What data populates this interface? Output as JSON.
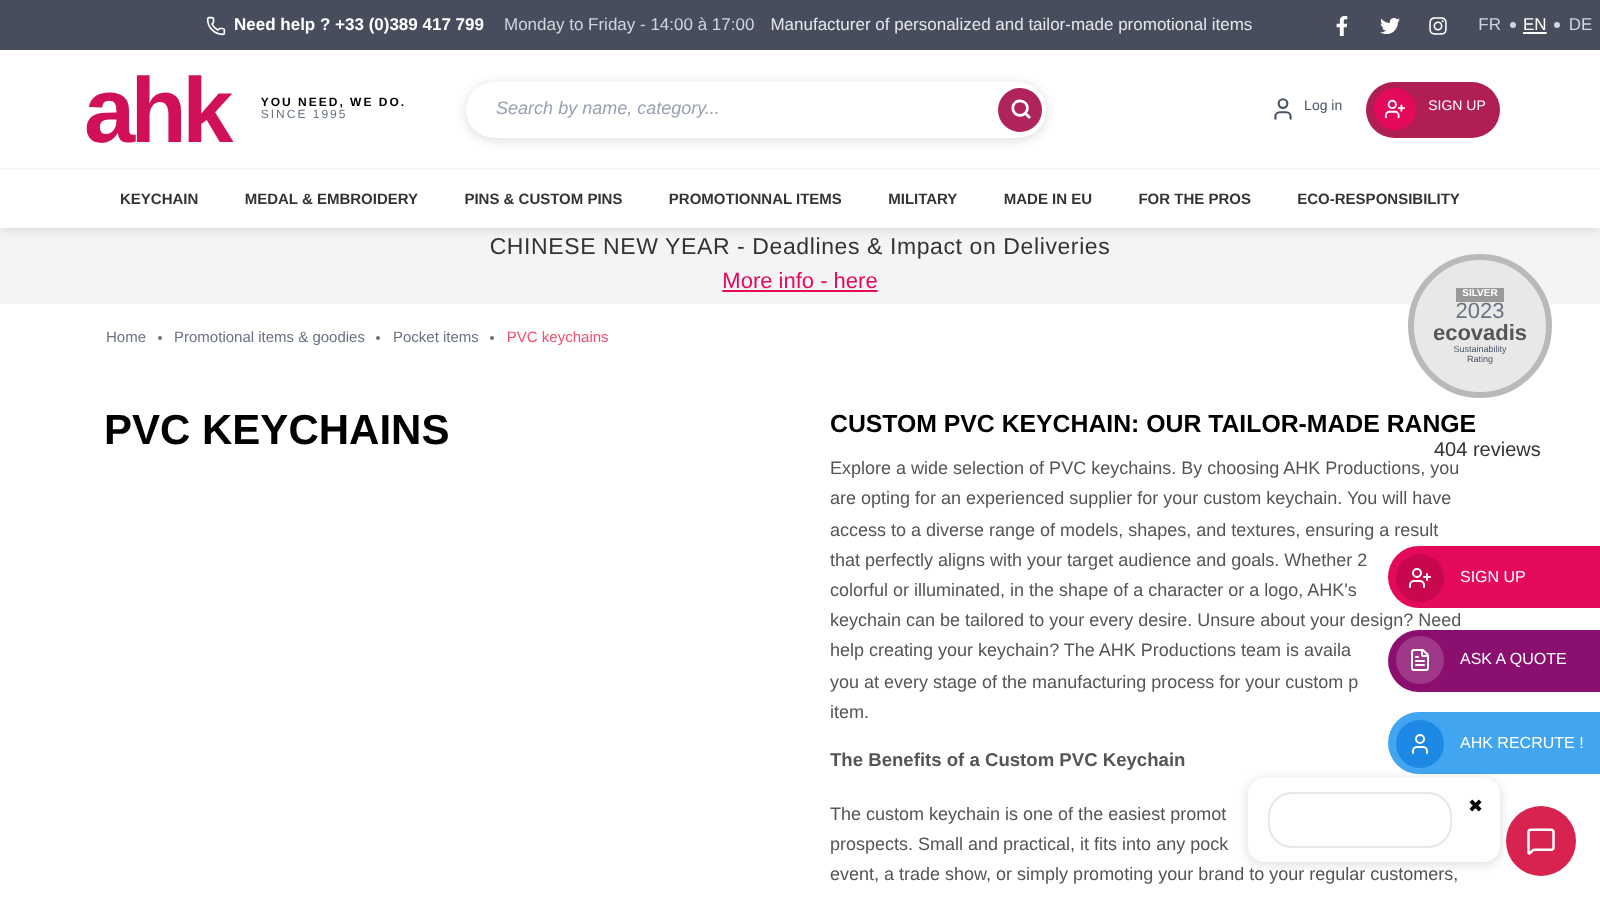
{
  "top_bar": {
    "help": "Need help ? +33 (0)389 417 799",
    "hours": "Monday to Friday - 14:00 à 17:00",
    "tagline": "Manufacturer of personalized and tailor-made promotional items",
    "languages": [
      {
        "label": "FR",
        "selected": false
      },
      {
        "label": "EN",
        "selected": true
      },
      {
        "label": "DE",
        "selected": false
      }
    ]
  },
  "header": {
    "logo": "ahk",
    "slogan": "YOU NEED, WE DO.",
    "since": "SINCE 1995",
    "search": {
      "placeholder": "Search by name, category..."
    },
    "login": "Log in",
    "signup": "SIGN UP"
  },
  "nav": [
    "KEYCHAIN",
    "MEDAL & EMBROIDERY",
    "PINS & CUSTOM PINS",
    "PROMOTIONNAL ITEMS",
    "MILITARY",
    "MADE IN EU",
    "FOR THE PROS",
    "ECO-RESPONSIBILITY"
  ],
  "banner": {
    "text": "CHINESE NEW YEAR - Deadlines & Impact on Deliveries",
    "link": "More info - here"
  },
  "breadcrumb": [
    {
      "label": "Home",
      "selected": false
    },
    {
      "label": "Promotional items & goodies",
      "selected": false
    },
    {
      "label": "Pocket items",
      "selected": false
    },
    {
      "label": "PVC keychains",
      "selected": true
    }
  ],
  "badge": {
    "level": "SILVER",
    "year": "2023",
    "brand": "ecovadis",
    "caption1": "Sustainability",
    "caption2": "Rating",
    "reviews": "404 reviews"
  },
  "page_title": "PVC KEYCHAINS",
  "content": {
    "heading": "CUSTOM PVC KEYCHAIN: OUR TAILOR-MADE RANGE",
    "paragraph_1": [
      "Explore a wide selection of PVC keychains. By choosing AHK Productions, you",
      "are opting for an experienced supplier for your custom keychain. You will have",
      "access to a diverse range of models, shapes, and textures, ensuring a result",
      "that perfectly aligns with your target audience and goals. Whether 2",
      "colorful or illuminated, in the shape of a character or a logo, AHK's",
      "keychain can be tailored to your every desire. Unsure about your design? Need",
      "help creating your keychain? The AHK Productions team is availa",
      "you at every stage of the manufacturing process for your custom p",
      "item."
    ],
    "subheading": "The Benefits of a Custom PVC Keychain",
    "paragraph_2": [
      "The custom keychain is one of the easiest promot",
      "prospects. Small and practical, it fits into any pock",
      "event, a trade show, or simply promoting your brand to your regular customers,"
    ]
  },
  "floating_buttons": [
    {
      "label": "SIGN UP",
      "kind": "signup"
    },
    {
      "label": "ASK A QUOTE",
      "kind": "quote"
    },
    {
      "label": "AHK RECRUTE !",
      "kind": "recruit"
    }
  ],
  "chat_popup": {
    "close": "✖"
  }
}
